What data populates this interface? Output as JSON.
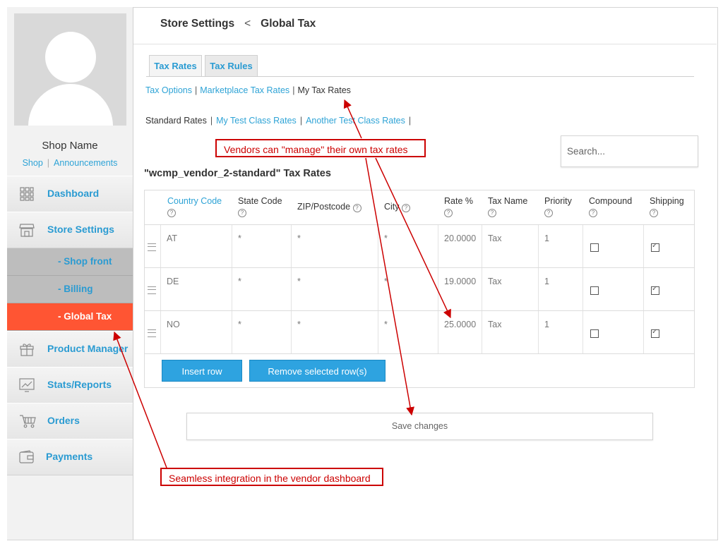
{
  "sidebar": {
    "shop_name": "Shop Name",
    "links": [
      "Shop",
      "Announcements"
    ],
    "items": [
      {
        "label": "Dashboard",
        "icon": "grid-icon"
      },
      {
        "label": "Store Settings",
        "icon": "store-icon"
      },
      {
        "label": "Product Manager",
        "icon": "gift-icon"
      },
      {
        "label": "Stats/Reports",
        "icon": "chart-icon"
      },
      {
        "label": "Orders",
        "icon": "cart-icon"
      },
      {
        "label": "Payments",
        "icon": "wallet-icon"
      }
    ],
    "subitems": [
      {
        "label": "- Shop front",
        "active": false
      },
      {
        "label": "- Billing",
        "active": false
      },
      {
        "label": "- Global Tax",
        "active": true
      }
    ],
    "active_color": "#ff5533"
  },
  "header": {
    "crumb1": "Store Settings",
    "separator": "<",
    "crumb2": "Global Tax"
  },
  "tabs": [
    "Tax Rates",
    "Tax Rules"
  ],
  "tax_links": [
    "Tax Options",
    "Marketplace Tax Rates",
    "My Tax Rates"
  ],
  "class_links": [
    "Standard Rates",
    "My Test Class Rates",
    "Another Test Class Rates"
  ],
  "search": {
    "placeholder": "Search..."
  },
  "table": {
    "title": "\"wcmp_vendor_2-standard\" Tax Rates",
    "columns": [
      "Country Code",
      "State Code",
      "ZIP/Postcode",
      "City",
      "Rate %",
      "Tax Name",
      "Priority",
      "Compound",
      "Shipping"
    ],
    "rows": [
      {
        "country": "AT",
        "state": "*",
        "zip": "*",
        "city": "*",
        "rate": "20.0000",
        "name": "Tax",
        "priority": "1",
        "compound": false,
        "shipping": true
      },
      {
        "country": "DE",
        "state": "*",
        "zip": "*",
        "city": "*",
        "rate": "19.0000",
        "name": "Tax",
        "priority": "1",
        "compound": false,
        "shipping": true
      },
      {
        "country": "NO",
        "state": "*",
        "zip": "*",
        "city": "*",
        "rate": "25.0000",
        "name": "Tax",
        "priority": "1",
        "compound": false,
        "shipping": true
      }
    ]
  },
  "buttons": {
    "insert": "Insert row",
    "remove": "Remove selected row(s)",
    "save": "Save changes"
  },
  "annotations": {
    "top": "Vendors can \"manage\" their own tax rates",
    "bottom": "Seamless integration in the vendor dashboard",
    "color": "#cc0000"
  }
}
